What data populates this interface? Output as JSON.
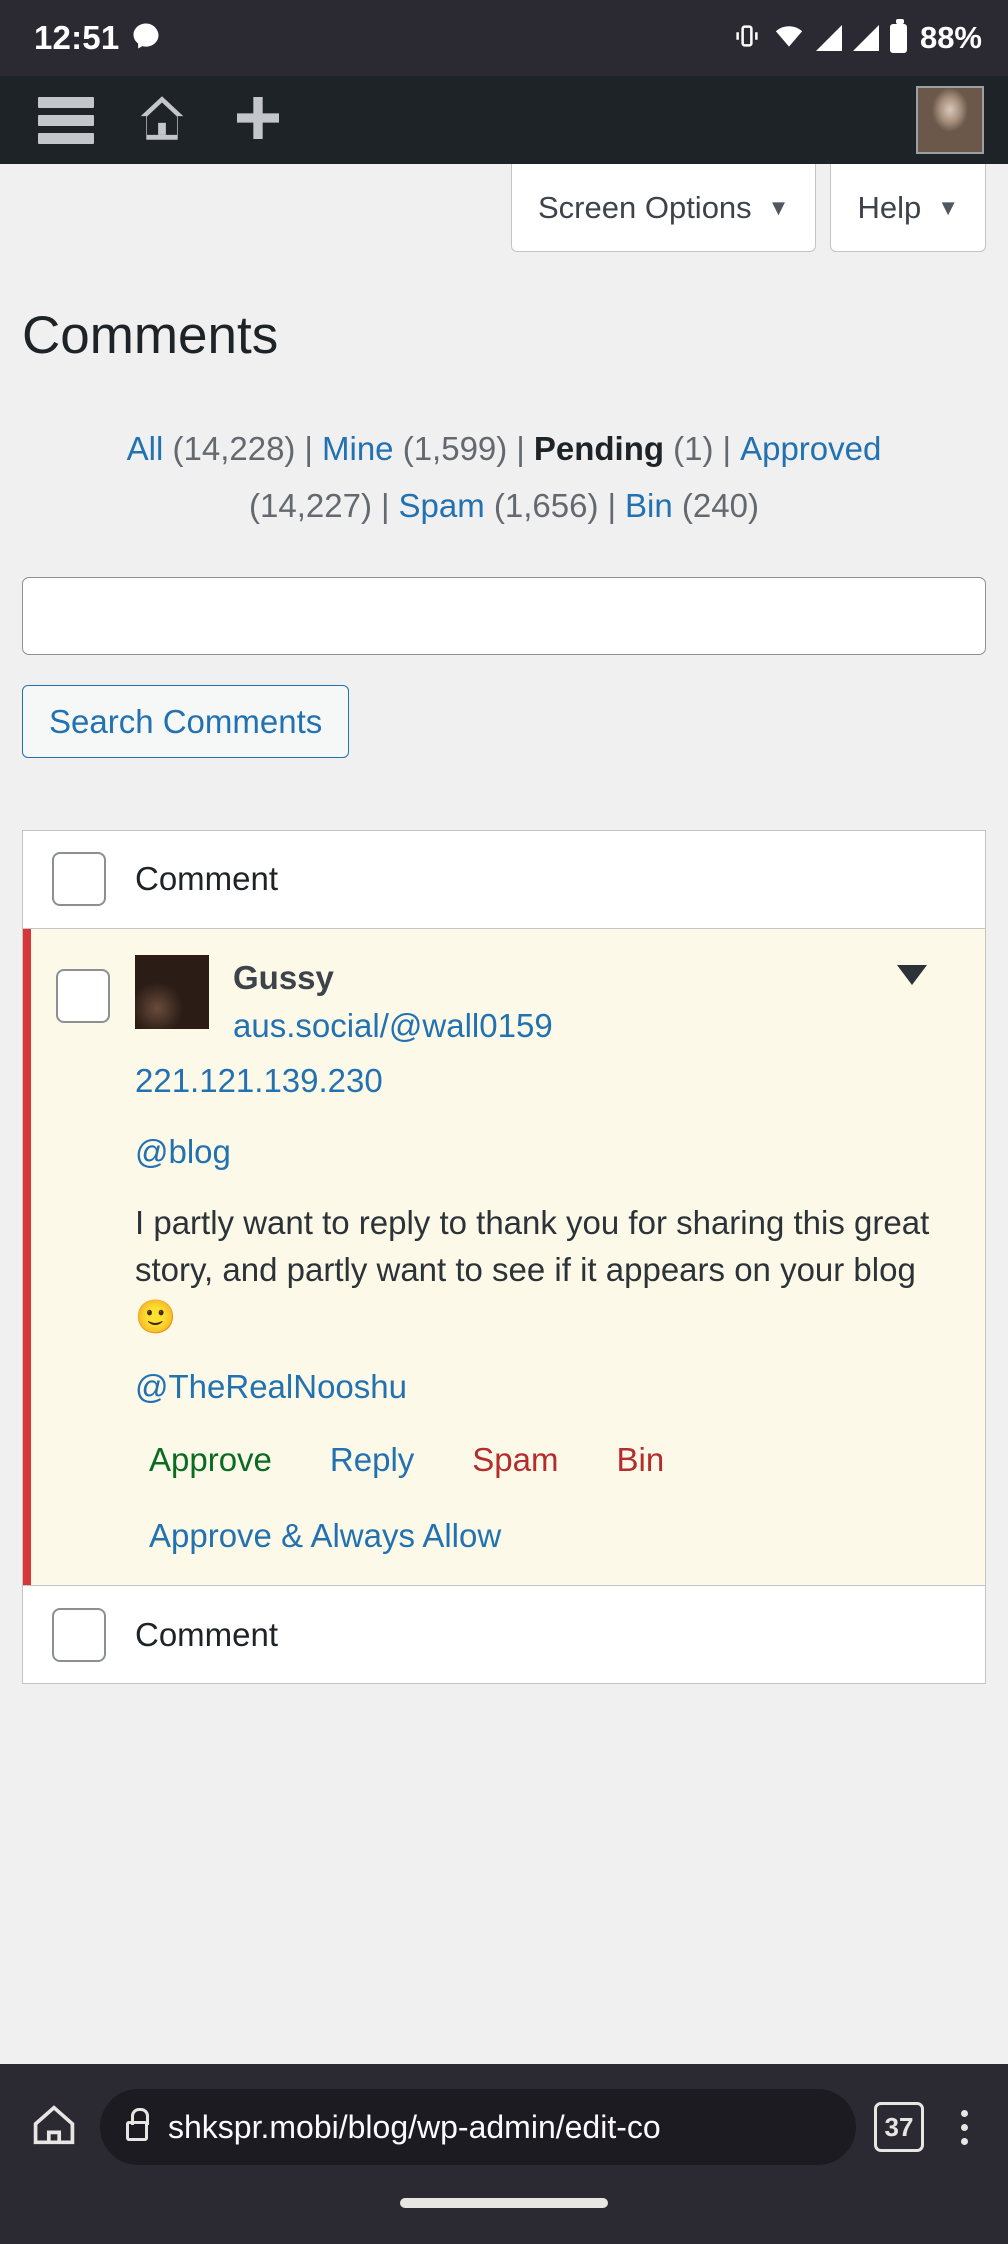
{
  "status_bar": {
    "clock": "12:51",
    "battery_percent": "88%",
    "icons": [
      "messenger-icon",
      "vibrate-icon",
      "wifi-icon",
      "signal-icon",
      "signal-icon-2",
      "battery-icon"
    ]
  },
  "admin_bar": {
    "menu_label": "menu-icon",
    "home_label": "home-icon",
    "new_label": "plus-icon",
    "avatar_label": "avatar"
  },
  "meta_tabs": {
    "screen_options": "Screen Options",
    "help": "Help",
    "caret": "▼"
  },
  "page": {
    "title": "Comments"
  },
  "filters": [
    {
      "label": "All",
      "count": "(14,228)",
      "current": false
    },
    {
      "label": "Mine",
      "count": "(1,599)",
      "current": false
    },
    {
      "label": "Pending",
      "count": "(1)",
      "current": true
    },
    {
      "label": "Approved",
      "count": "(14,227)",
      "current": false
    },
    {
      "label": "Spam",
      "count": "(1,656)",
      "current": false
    },
    {
      "label": "Bin",
      "count": "(240)",
      "current": false
    }
  ],
  "separator": "|",
  "search": {
    "value": "",
    "placeholder": "",
    "button_label": "Search Comments"
  },
  "table": {
    "header_column": "Comment",
    "footer_column": "Comment"
  },
  "comment": {
    "author": "Gussy",
    "author_url": "aus.social/@wall0159",
    "ip": "221.121.139.230",
    "mention_top": "@blog",
    "text": "I partly want to reply to thank you for sharing this great story, and partly want to see if it appears on your blog 🙂",
    "mention_bottom": "@TheRealNooshu",
    "caret": "▼",
    "actions": {
      "approve": "Approve",
      "reply": "Reply",
      "spam": "Spam",
      "bin": "Bin",
      "approve_always": "Approve & Always Allow"
    },
    "status_color": "#d63638",
    "row_background": "#fcf9e8"
  },
  "browser": {
    "url": "shkspr.mobi/blog/wp-admin/edit-co",
    "tab_count": "37",
    "home_icon": "home-icon",
    "lock_icon": "lock-icon",
    "menu_icon": "kebab-menu-icon"
  }
}
